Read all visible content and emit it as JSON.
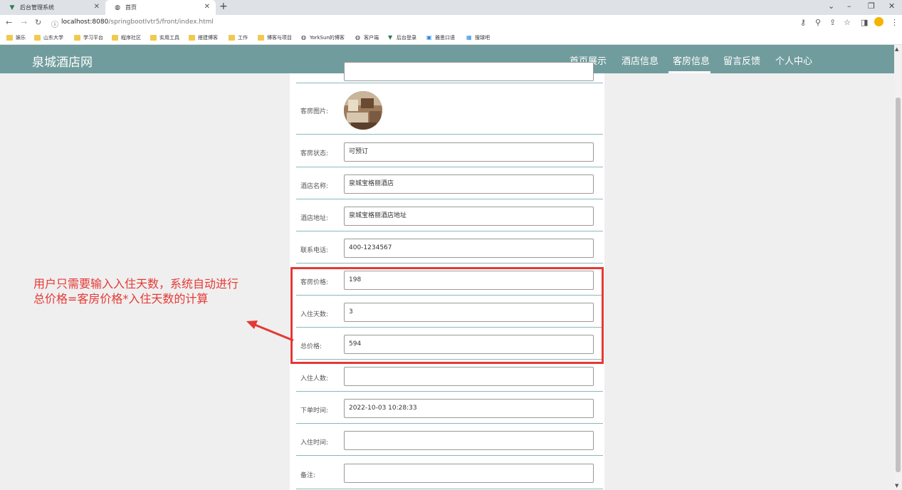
{
  "browser": {
    "tabs": [
      {
        "label": "后台管理系统",
        "active": false
      },
      {
        "label": "首页",
        "active": true
      }
    ],
    "url_host": "localhost:8080",
    "url_path": "/springbootlvtr5/front/index.html",
    "bookmarks": [
      "娱乐",
      "山东大学",
      "学习平台",
      "程序社区",
      "实用工具",
      "搭建博客",
      "工作",
      "博客与项目",
      "YorkSun的博客",
      "客户端",
      "后台登录",
      "雅思口语",
      "搜球吧"
    ]
  },
  "site": {
    "brand": "泉城酒店网",
    "nav": [
      "首页展示",
      "酒店信息",
      "客房信息",
      "留言反馈",
      "个人中心"
    ],
    "active_nav": "客房信息"
  },
  "form": {
    "image_label": "客房图片:",
    "fields": [
      {
        "label": "客房状态:",
        "value": "可预订"
      },
      {
        "label": "酒店名称:",
        "value": "泉城宝格丽酒店"
      },
      {
        "label": "酒店地址:",
        "value": "泉城宝格丽酒店地址"
      },
      {
        "label": "联系电话:",
        "value": "400-1234567"
      },
      {
        "label": "客房价格:",
        "value": "198"
      },
      {
        "label": "入住天数:",
        "value": "3"
      },
      {
        "label": "总价格:",
        "value": "594"
      },
      {
        "label": "入住人数:",
        "value": ""
      },
      {
        "label": "下单时间:",
        "value": "2022-10-03 10:28:33"
      },
      {
        "label": "入住时间:",
        "value": ""
      },
      {
        "label": "备注:",
        "value": ""
      }
    ]
  },
  "annotation": {
    "line1": "用户只需要输入入住天数，系统自动进行",
    "line2": "总价格=客房价格*入住天数的计算",
    "color": "#e53935"
  }
}
